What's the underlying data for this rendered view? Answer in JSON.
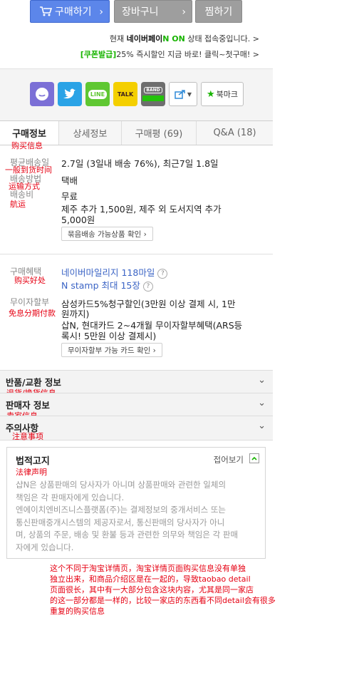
{
  "buttons": {
    "buy": "구매하기",
    "cart": "장바구니",
    "wish": "찜하기"
  },
  "npay": {
    "prefix": "현재 ",
    "brand": "네이버페이",
    "on": "N ON",
    "suffix": " 상태 접속중입니다. >",
    "coupon_tag": "[쿠폰발급]",
    "coupon_text": "25% 즉시할인 지금 바로! 클릭~첫구매! >"
  },
  "share": {
    "sns": [
      "ㅇ",
      "t",
      "LINE",
      "TALK",
      "BAND"
    ],
    "bookmark": "북마크"
  },
  "tabs": [
    "구매정보",
    "상세정보",
    "구매평 (69)",
    "Q&A (18)"
  ],
  "purchase": {
    "ann_tab": "购买信息",
    "delivery_label": "평균배송일",
    "delivery_value": "2.7일 (3일내 배송 76%), 최근7일 1.8일",
    "ann_delivery": "一般到货时间",
    "method_label": "배송방법",
    "method_value": "택배",
    "ann_method": "运输方式",
    "fee_label": "배송비",
    "fee_value": "무료",
    "ann_fee": "航运",
    "fee_extra1": "제주 추가 1,500원, 제주 외 도서지역 추가",
    "fee_extra2": "5,000원",
    "bundle_btn": "묶음배송 가능상품 확인  ›"
  },
  "benefit": {
    "label": "구매혜택",
    "ann": "购买好处",
    "mileage": "네이버마일리지 118마일",
    "stamp": "N stamp 최대 15장",
    "qmark": "?"
  },
  "installment": {
    "label": "무이자할부",
    "ann": "免息分期付款",
    "line1": "삼성카드5%청구할인(3만원 이상 결제 시, 1만",
    "line2": "원까지)",
    "line3": "삽N, 현대카드 2~4개월 무이자할부혜택(ARS등",
    "line4": "록시! 5만원 이상 결제시)",
    "btn": "무이자할부 가능 카드 확인  ›"
  },
  "accordion": [
    {
      "title": "반품/교환 정보",
      "ann": "退货/换货信息"
    },
    {
      "title": "판매자 정보",
      "ann": "卖家信息"
    },
    {
      "title": "주의사항",
      "ann": "注意事项"
    }
  ],
  "legal": {
    "title": "법적고지",
    "ann": "法律声明",
    "collapse": "접어보기",
    "lines": [
      "샵N은 상품판매의 당사자가 아니며 상품판매와 관련한 일체의",
      "책임은 각 판매자에게 있습니다.",
      "엔에이치엔비즈니스플랫폼(주)는 결제정보의 중개서비스 또는",
      "통신판매중개시스템의 제공자로서, 통신판매의 당사자가 아니",
      "며, 상품의 주문, 배송 및 환불 등과 관련한 의무와 책임은 각 판매",
      "자에게 있습니다."
    ]
  },
  "note_lines": [
    "这个不同于淘宝详情页，淘宝详情页面购买信息没有单独",
    "独立出来，和商品介绍区是在一起的，导致taobao detail",
    "页面很长，其中有一大部分包含这块内容，尤其是同一家店",
    "的这一部分都是一样的，比较一家店的东西看不同detail会有很多",
    "重复的购买信息"
  ],
  "colors": {
    "buy": "#5c86ea",
    "gray_btn": "#9e9e9e",
    "naver_green": "#18b400",
    "annotation": "#e60012"
  }
}
